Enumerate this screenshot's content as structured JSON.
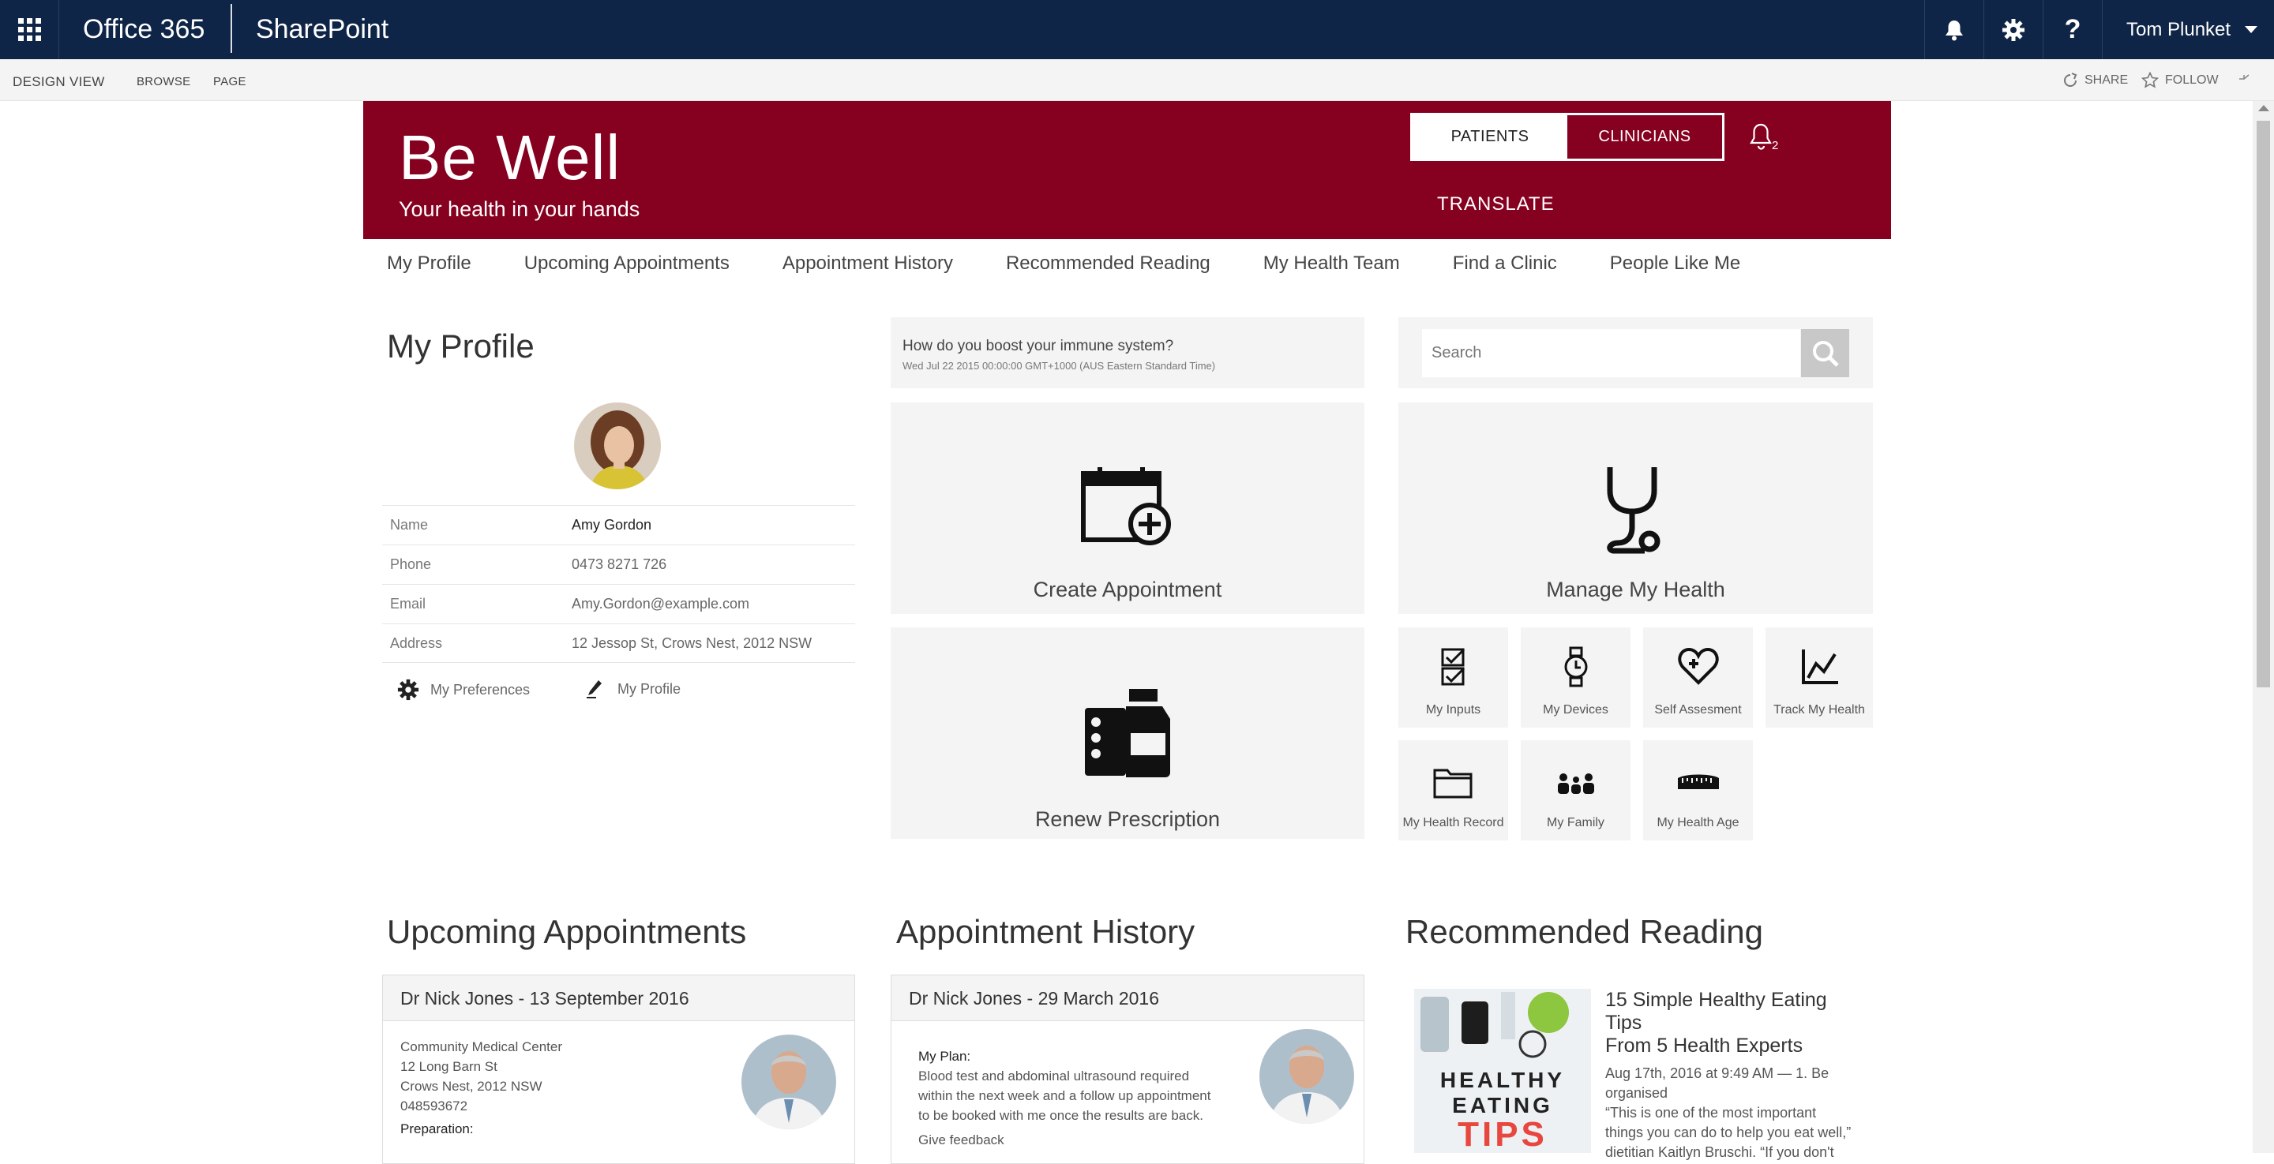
{
  "suite": {
    "product": "Office 365",
    "app": "SharePoint",
    "user": "Tom Plunket"
  },
  "ribbon": {
    "design_view": "DESIGN VIEW",
    "browse": "BROWSE",
    "page": "PAGE",
    "share": "SHARE",
    "follow": "FOLLOW"
  },
  "banner": {
    "title": "Be Well",
    "subtitle": "Your health in your hands",
    "toggle_patients": "PATIENTS",
    "toggle_clinicians": "CLINICIANS",
    "notification_count": "2",
    "translate": "TRANSLATE"
  },
  "nav": [
    "My Profile",
    "Upcoming Appointments",
    "Appointment History",
    "Recommended Reading",
    "My Health Team",
    "Find a Clinic",
    "People Like Me"
  ],
  "profile": {
    "heading": "My Profile",
    "rows": [
      {
        "label": "Name",
        "value": "Amy Gordon"
      },
      {
        "label": "Phone",
        "value": "0473 8271 726"
      },
      {
        "label": "Email",
        "value": "Amy.Gordon@example.com"
      },
      {
        "label": "Address",
        "value": "12 Jessop St, Crows Nest, 2012 NSW"
      }
    ],
    "preferences_link": "My Preferences",
    "profile_link": "My Profile"
  },
  "news": {
    "question": "How do you boost your immune system?",
    "date": "Wed Jul 22 2015 00:00:00 GMT+1000 (AUS Eastern Standard Time)"
  },
  "search": {
    "placeholder": "Search"
  },
  "tiles": {
    "create_appointment": "Create Appointment",
    "manage_health": "Manage My Health",
    "renew_prescription": "Renew Prescription",
    "my_inputs": "My Inputs",
    "my_devices": "My Devices",
    "self_assessment": "Self Assesment",
    "track_health": "Track My Health",
    "health_record": "My Health Record",
    "my_family": "My Family",
    "health_age": "My Health Age"
  },
  "upcoming": {
    "heading": "Upcoming Appointments",
    "title": "Dr Nick Jones - 13 September 2016",
    "lines": [
      "Community Medical Center",
      "12 Long Barn St",
      "Crows Nest, 2012 NSW",
      "048593672"
    ],
    "prep_label": "Preparation:"
  },
  "history": {
    "heading": "Appointment History",
    "title": "Dr Nick Jones - 29 March 2016",
    "plan_label": "My Plan:",
    "plan_lines": [
      "Blood test and abdominal ultrasound required",
      "within the next week and a follow up appointment",
      "to be booked with me once the results are back."
    ],
    "feedback": "Give feedback"
  },
  "reading": {
    "heading": "Recommended Reading",
    "image_text_1": "HEALTHY",
    "image_text_2": "EATING",
    "image_text_3": "TIPS",
    "article_title_1": "15 Simple Healthy Eating Tips",
    "article_title_2": "From 5 Health Experts",
    "meta_1": "Aug 17th, 2016 at 9:49 AM — 1. Be",
    "meta_2": "organised",
    "excerpt_1": "“This is one of the most important",
    "excerpt_2": "things you can do to help you eat well,”",
    "excerpt_3": "dietitian Kaitlyn Bruschi. “If you don't"
  },
  "colors": {
    "suite_bar": "#0f2547",
    "brand": "#860020",
    "tile": "#f4f4f4"
  }
}
